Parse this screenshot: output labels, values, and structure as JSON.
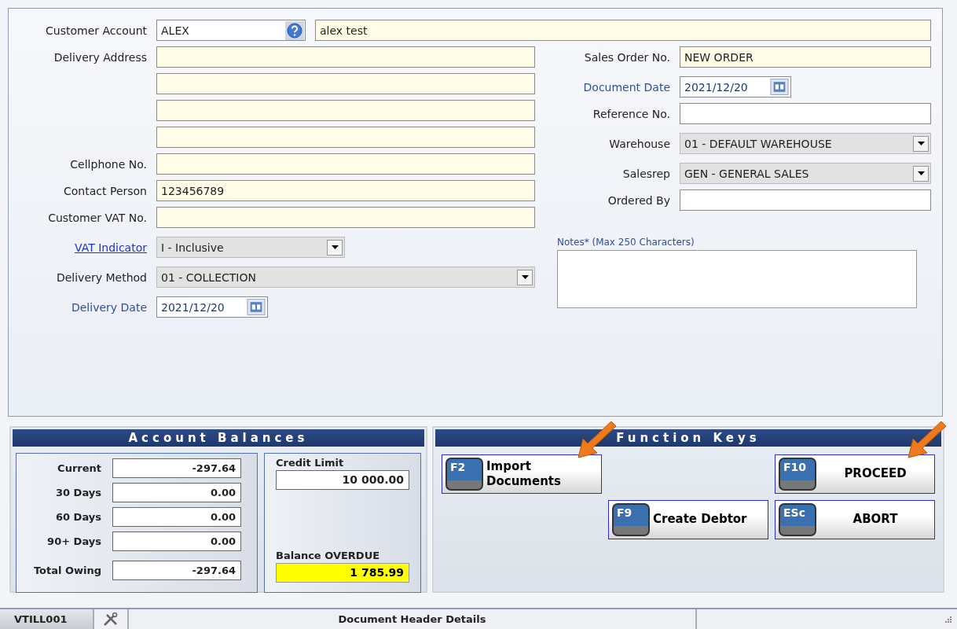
{
  "customer_account": {
    "label": "Customer Account",
    "code": "ALEX",
    "name": "alex test"
  },
  "left_fields": [
    {
      "label": "Delivery Address",
      "link": false,
      "accent": false,
      "kind": "entry",
      "short": false
    },
    {
      "kind": "entry",
      "short": false
    },
    {
      "kind": "entry",
      "short": false
    },
    {
      "kind": "entry",
      "short": false
    },
    {
      "label": "Cellphone No.",
      "link": false,
      "accent": false,
      "kind": "entry",
      "short": false
    },
    {
      "label": "Contact Person",
      "link": false,
      "accent": false,
      "kind": "entry",
      "value": "123456789",
      "short": false
    },
    {
      "label": "Customer VAT No.",
      "link": false,
      "accent": false,
      "kind": "entry",
      "short": false
    },
    {
      "label": "VAT Indicator",
      "link": true,
      "accent": false,
      "kind": "dropdown",
      "value": "I - Inclusive",
      "short": true
    },
    {
      "label": "Delivery Method",
      "link": false,
      "accent": false,
      "kind": "dropdown",
      "value": "01 - COLLECTION",
      "short": false
    },
    {
      "label": "Delivery Date",
      "link": false,
      "accent": true,
      "kind": "date",
      "value": "2021/12/20",
      "short": true
    }
  ],
  "right_fields": [
    {
      "label": "Sales Order No.",
      "link": false,
      "accent": false,
      "kind": "entry",
      "value": "NEW ORDER",
      "short": false
    },
    {
      "label": "Document Date",
      "link": false,
      "accent": true,
      "kind": "date",
      "value": "2021/12/20",
      "short": true
    },
    {
      "label": "Reference No.",
      "link": false,
      "accent": false,
      "kind": "plain",
      "short": false
    },
    {
      "label": "Warehouse",
      "link": false,
      "accent": false,
      "kind": "dropdown",
      "value": "01 - DEFAULT WAREHOUSE",
      "short": false
    },
    {
      "label": "Salesrep",
      "link": false,
      "accent": false,
      "kind": "dropdown",
      "value": "GEN - GENERAL SALES",
      "short": false
    },
    {
      "label": "Ordered By",
      "link": false,
      "accent": false,
      "kind": "plain",
      "short": false
    }
  ],
  "notes": {
    "label": "Notes* (Max 250 Characters)"
  },
  "account_balances": {
    "title": "Account Balances",
    "rows": [
      {
        "label": "Current",
        "value": "-297.64"
      },
      {
        "label": "30 Days",
        "value": "0.00"
      },
      {
        "label": "60 Days",
        "value": "0.00"
      },
      {
        "label": "90+ Days",
        "value": "0.00"
      },
      {
        "label": "Total Owing",
        "value": "-297.64"
      }
    ],
    "credit_limit": {
      "label": "Credit Limit",
      "value": "10 000.00"
    },
    "balance_overdue": {
      "label": "Balance OVERDUE",
      "value": "1 785.99"
    }
  },
  "function_keys": {
    "title": "Function Keys",
    "buttons": [
      {
        "key": "F2",
        "label": "Import Documents",
        "highlighted": true
      },
      {
        "key": "F10",
        "label": "PROCEED",
        "highlighted": true
      },
      {
        "key": "F9",
        "label": "Create Debtor",
        "highlighted": false
      },
      {
        "key": "ESc",
        "label": "ABORT",
        "highlighted": false
      }
    ]
  },
  "status_bar": {
    "code": "VTILL001",
    "message": "Document Header Details"
  }
}
